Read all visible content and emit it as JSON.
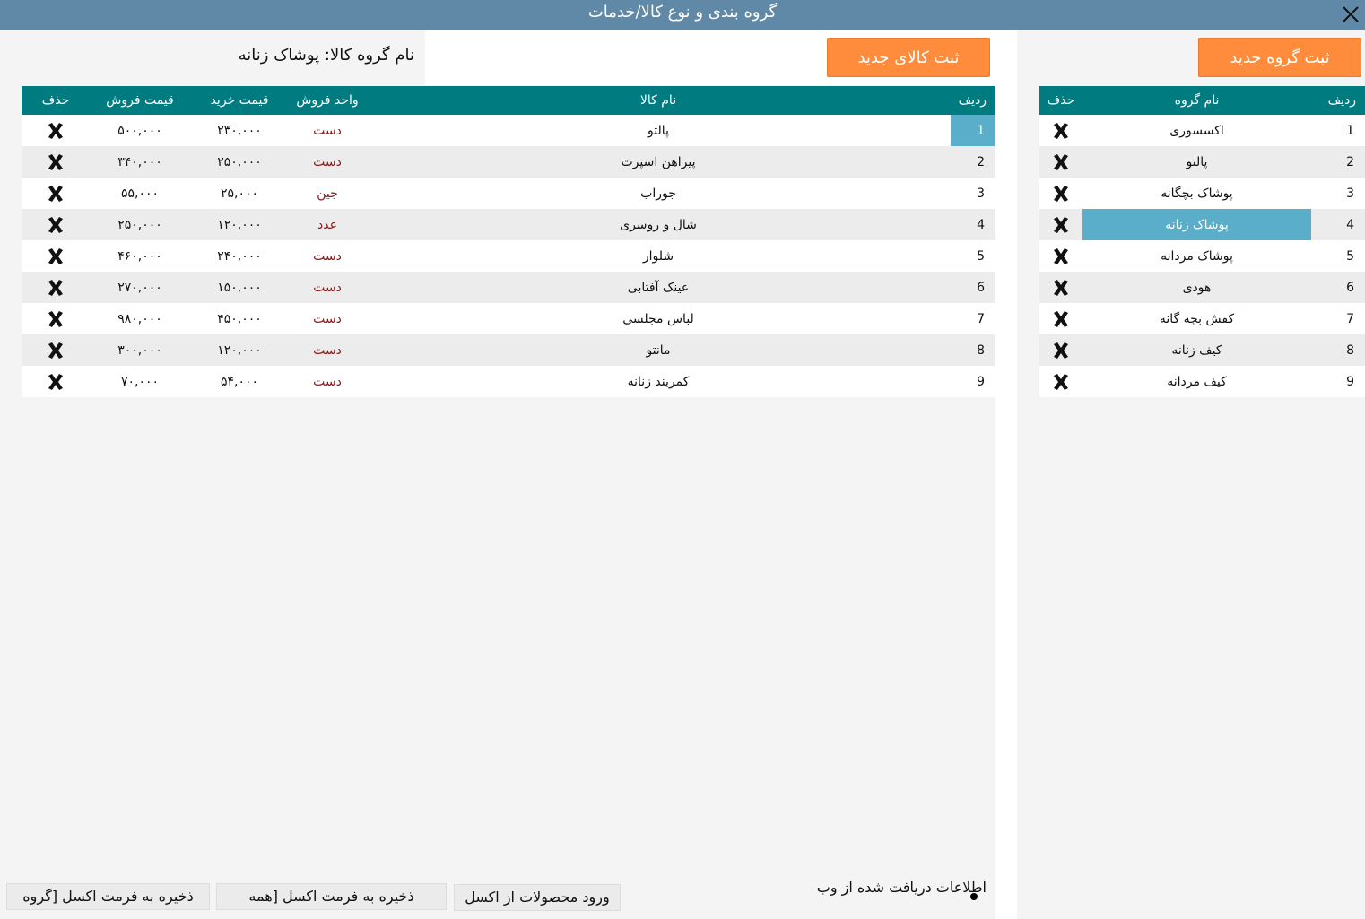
{
  "window": {
    "title": "گروه بندی و نوع کالا/خدمات"
  },
  "buttons": {
    "new_group": "ثبت گروه جدید",
    "new_item": "ثبت کالای جدید",
    "import_excel": "ورود محصولات از اکسل",
    "save_excel_all": "ذخیره به فرمت اکسل [همه",
    "save_excel_group": "ذخیره به فرمت اکسل [گروه"
  },
  "group_label": "نام گروه کالا: پوشاک زنانه",
  "groups": {
    "headers": {
      "row": "ردیف",
      "name": "نام گروه",
      "delete": "حذف"
    },
    "selected_index": 3,
    "rows": [
      {
        "num": "1",
        "name": "اکسسوری"
      },
      {
        "num": "2",
        "name": "پالتو"
      },
      {
        "num": "3",
        "name": "پوشاک بچگانه"
      },
      {
        "num": "4",
        "name": "پوشاک زنانه"
      },
      {
        "num": "5",
        "name": "پوشاک مردانه"
      },
      {
        "num": "6",
        "name": "هودی"
      },
      {
        "num": "7",
        "name": "کفش بچه گانه"
      },
      {
        "num": "8",
        "name": "کیف زنانه"
      },
      {
        "num": "9",
        "name": "کیف مردانه"
      }
    ]
  },
  "items": {
    "headers": {
      "row": "ردیف",
      "name": "نام کالا",
      "unit": "واحد فروش",
      "buy": "قیمت خرید",
      "sell": "قیمت فروش",
      "delete": "حذف"
    },
    "selected_index": 0,
    "rows": [
      {
        "num": "1",
        "name": "پالتو",
        "unit": "دست",
        "buy": "۲۳۰,۰۰۰",
        "sell": "۵۰۰,۰۰۰"
      },
      {
        "num": "2",
        "name": "پیراهن اسپرت",
        "unit": "دست",
        "buy": "۲۵۰,۰۰۰",
        "sell": "۳۴۰,۰۰۰"
      },
      {
        "num": "3",
        "name": "جوراب",
        "unit": "جین",
        "buy": "۲۵,۰۰۰",
        "sell": "۵۵,۰۰۰"
      },
      {
        "num": "4",
        "name": "شال و روسری",
        "unit": "عدد",
        "buy": "۱۲۰,۰۰۰",
        "sell": "۲۵۰,۰۰۰"
      },
      {
        "num": "5",
        "name": "شلوار",
        "unit": "دست",
        "buy": "۲۴۰,۰۰۰",
        "sell": "۴۶۰,۰۰۰"
      },
      {
        "num": "6",
        "name": "عینک آفتابی",
        "unit": "دست",
        "buy": "۱۵۰,۰۰۰",
        "sell": "۲۷۰,۰۰۰"
      },
      {
        "num": "7",
        "name": "لباس مجلسی",
        "unit": "دست",
        "buy": "۴۵۰,۰۰۰",
        "sell": "۹۸۰,۰۰۰"
      },
      {
        "num": "8",
        "name": "مانتو",
        "unit": "دست",
        "buy": "۱۲۰,۰۰۰",
        "sell": "۳۰۰,۰۰۰"
      },
      {
        "num": "9",
        "name": "کمربند زنانه",
        "unit": "دست",
        "buy": "۵۴,۰۰۰",
        "sell": "۷۰,۰۰۰"
      }
    ]
  },
  "web_info": "اطلاعات دریافت شده از وب",
  "icons": {
    "close": "close-icon",
    "delete": "delete-x-icon"
  },
  "colors": {
    "titlebar": "#6089a8",
    "header": "#007b80",
    "accent": "#ff8c3c",
    "selected": "#5aaec9",
    "unit_text": "#8b1a1a"
  }
}
